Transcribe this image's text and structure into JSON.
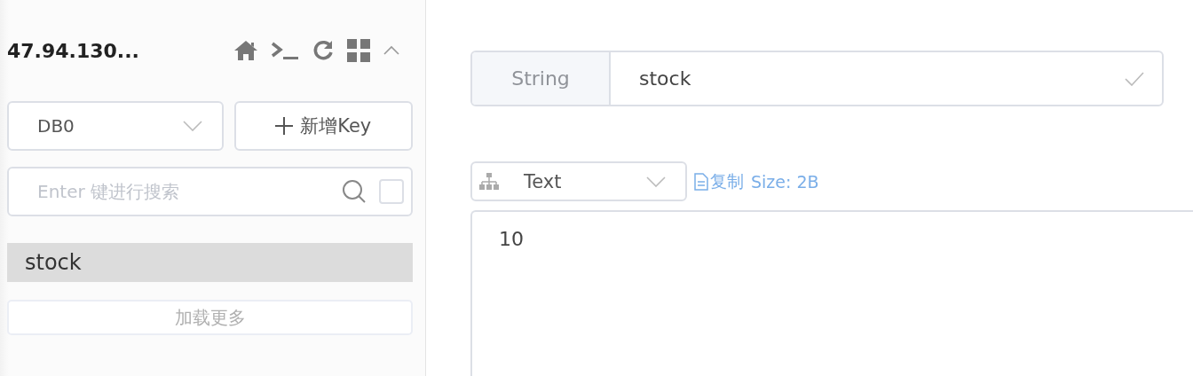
{
  "connection": {
    "title": "47.94.130..."
  },
  "db_select": {
    "value": "DB0"
  },
  "new_key_button": {
    "label": "新增Key"
  },
  "search": {
    "placeholder": "Enter 键进行搜索",
    "exact_match": false
  },
  "keys": [
    {
      "name": "stock",
      "selected": true
    }
  ],
  "load_more": {
    "label": "加载更多"
  },
  "key_detail": {
    "type": "String",
    "name": "stock"
  },
  "viewer": {
    "format": "Text",
    "copy_label": "复制",
    "size": "Size: 2B",
    "value": "10"
  }
}
